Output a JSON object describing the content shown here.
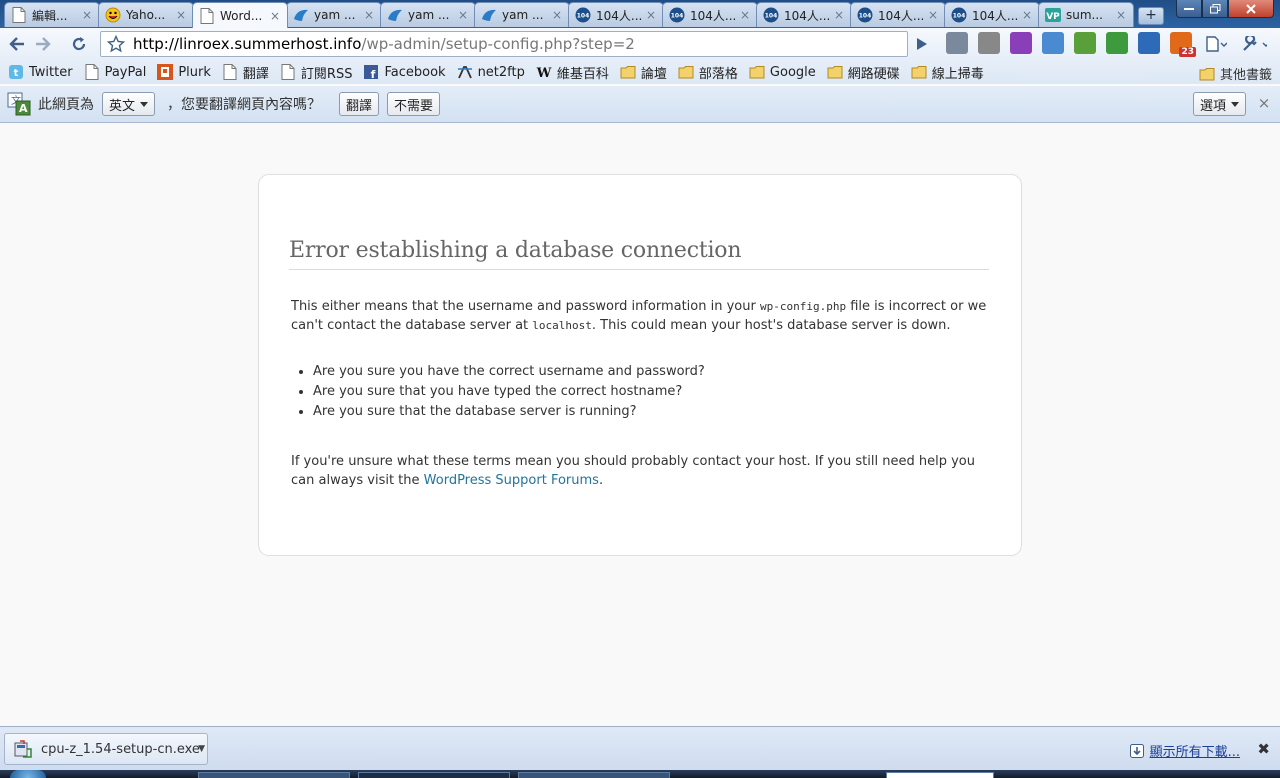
{
  "tabs": [
    {
      "title": "編輯...",
      "icon": "page-icon",
      "active": false
    },
    {
      "title": "Yaho...",
      "icon": "yahoo-smiley-icon",
      "active": false
    },
    {
      "title": "Word...",
      "icon": "page-icon",
      "active": true
    },
    {
      "title": "yam ...",
      "icon": "yam-icon",
      "active": false
    },
    {
      "title": "yam ...",
      "icon": "yam-icon",
      "active": false
    },
    {
      "title": "yam ...",
      "icon": "yam-icon",
      "active": false
    },
    {
      "title": "104人...",
      "icon": "104-icon",
      "active": false
    },
    {
      "title": "104人...",
      "icon": "104-icon",
      "active": false
    },
    {
      "title": "104人...",
      "icon": "104-icon",
      "active": false
    },
    {
      "title": "104人...",
      "icon": "104-icon",
      "active": false
    },
    {
      "title": "104人...",
      "icon": "104-icon",
      "active": false
    },
    {
      "title": "sum...",
      "icon": "vp-icon",
      "active": false
    }
  ],
  "tab_close_glyph": "×",
  "new_tab_glyph": "+",
  "address": {
    "host": "http://linroex.summerhost.info",
    "path": "/wp-admin/setup-config.php?step=2"
  },
  "extensions": [
    {
      "name": "tools-icon",
      "color": "#7a8a9c",
      "badge": ""
    },
    {
      "name": "wikipedia-icon",
      "color": "#888888",
      "badge": ""
    },
    {
      "name": "plurk-icon",
      "color": "#8a3fb8",
      "badge": ""
    },
    {
      "name": "ie-tab-icon",
      "color": "#4a8ad0",
      "badge": ""
    },
    {
      "name": "evernote-icon",
      "color": "#5aa03a",
      "badge": ""
    },
    {
      "name": "refresh-ext-icon",
      "color": "#3d9a3d",
      "badge": ""
    },
    {
      "name": "seo-icon",
      "color": "#2d6ab7",
      "badge": ""
    },
    {
      "name": "rss-reader-icon",
      "color": "#e06a1a",
      "badge": "23"
    }
  ],
  "bookmarks": [
    {
      "label": "Twitter",
      "icon": "twitter-icon"
    },
    {
      "label": "PayPal",
      "icon": "page-icon"
    },
    {
      "label": "Plurk",
      "icon": "plurk-icon"
    },
    {
      "label": "翻譯",
      "icon": "page-icon"
    },
    {
      "label": "訂閱RSS",
      "icon": "page-icon"
    },
    {
      "label": "Facebook",
      "icon": "facebook-icon"
    },
    {
      "label": "net2ftp",
      "icon": "net2ftp-icon"
    },
    {
      "label": "維基百科",
      "icon": "wikipedia-icon"
    },
    {
      "label": "論壇",
      "icon": "folder-icon"
    },
    {
      "label": "部落格",
      "icon": "folder-icon"
    },
    {
      "label": "Google",
      "icon": "folder-icon"
    },
    {
      "label": "網路硬碟",
      "icon": "folder-icon"
    },
    {
      "label": "線上掃毒",
      "icon": "folder-icon"
    }
  ],
  "other_bookmarks": "其他書籤",
  "translate_bar": {
    "prefix": "此網頁為",
    "language": "英文",
    "question": "，您要翻譯網頁內容嗎？",
    "translate_btn": "翻譯",
    "decline_btn": "不需要",
    "options_btn": "選項",
    "close_glyph": "×"
  },
  "content": {
    "heading": "Error establishing a database connection",
    "p1_a": "This either means that the username and password information in your ",
    "p1_code1": "wp-config.php",
    "p1_b": " file is incorrect or we can't contact the database server at ",
    "p1_code2": "localhost",
    "p1_c": ". This could mean your host's database server is down.",
    "bullets": [
      "Are you sure you have the correct username and password?",
      "Are you sure that you have typed the correct hostname?",
      "Are you sure that the database server is running?"
    ],
    "p2_a": "If you're unsure what these terms mean you should probably contact your host. If you still need help you can always visit the ",
    "p2_link": "WordPress Support Forums",
    "p2_b": "."
  },
  "download": {
    "filename": "cpu-z_1.54-setup-cn.exe",
    "show_all": "顯示所有下載...",
    "close_glyph": "✖"
  }
}
